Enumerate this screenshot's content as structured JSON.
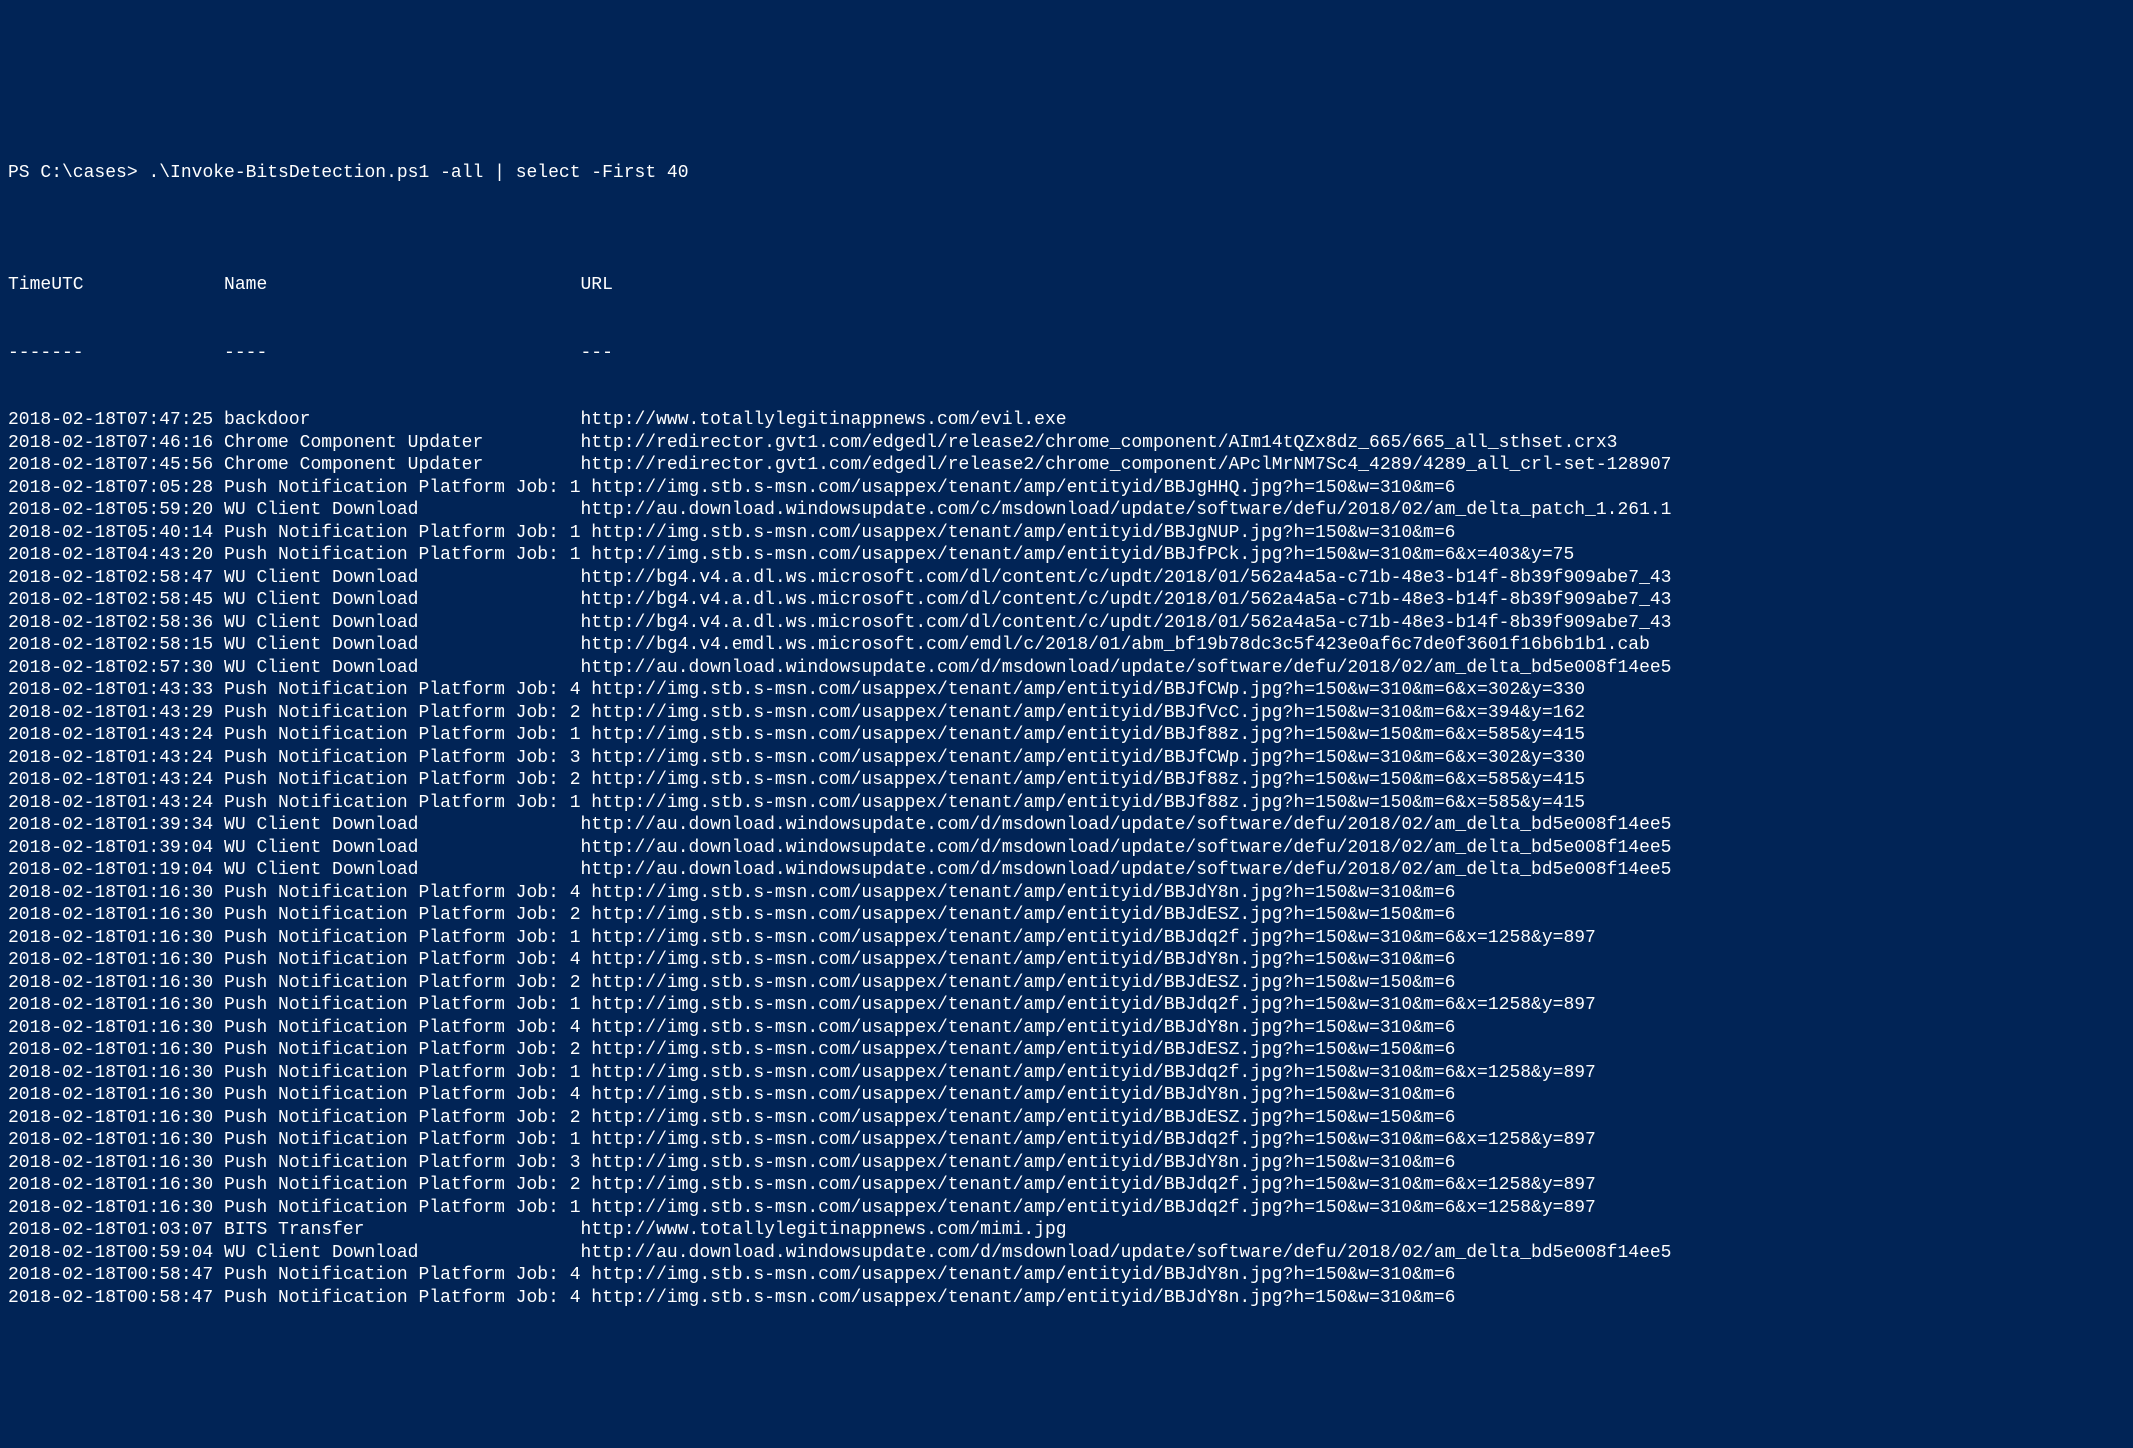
{
  "terminal": {
    "prompt": "PS C:\\cases> ",
    "command": ".\\Invoke-BitsDetection.ps1 -all | select -First 40",
    "blank_line": "",
    "columns": {
      "time_hdr": "TimeUTC",
      "name_hdr": "Name",
      "url_hdr": "URL",
      "time_sep": "-------",
      "name_sep": "----",
      "url_sep": "---"
    },
    "col_time_width": 20,
    "col_name_width": 33,
    "rows": [
      {
        "time": "2018-02-18T07:47:25",
        "name": "backdoor",
        "url": "http://www.totallylegitinappnews.com/evil.exe"
      },
      {
        "time": "2018-02-18T07:46:16",
        "name": "Chrome Component Updater",
        "url": "http://redirector.gvt1.com/edgedl/release2/chrome_component/AIm14tQZx8dz_665/665_all_sthset.crx3"
      },
      {
        "time": "2018-02-18T07:45:56",
        "name": "Chrome Component Updater",
        "url": "http://redirector.gvt1.com/edgedl/release2/chrome_component/APclMrNM7Sc4_4289/4289_all_crl-set-128907"
      },
      {
        "time": "2018-02-18T07:05:28",
        "name": "Push Notification Platform Job: 1",
        "url": "http://img.stb.s-msn.com/usappex/tenant/amp/entityid/BBJgHHQ.jpg?h=150&w=310&m=6"
      },
      {
        "time": "2018-02-18T05:59:20",
        "name": "WU Client Download",
        "url": "http://au.download.windowsupdate.com/c/msdownload/update/software/defu/2018/02/am_delta_patch_1.261.1"
      },
      {
        "time": "2018-02-18T05:40:14",
        "name": "Push Notification Platform Job: 1",
        "url": "http://img.stb.s-msn.com/usappex/tenant/amp/entityid/BBJgNUP.jpg?h=150&w=310&m=6"
      },
      {
        "time": "2018-02-18T04:43:20",
        "name": "Push Notification Platform Job: 1",
        "url": "http://img.stb.s-msn.com/usappex/tenant/amp/entityid/BBJfPCk.jpg?h=150&w=310&m=6&x=403&y=75"
      },
      {
        "time": "2018-02-18T02:58:47",
        "name": "WU Client Download",
        "url": "http://bg4.v4.a.dl.ws.microsoft.com/dl/content/c/updt/2018/01/562a4a5a-c71b-48e3-b14f-8b39f909abe7_43"
      },
      {
        "time": "2018-02-18T02:58:45",
        "name": "WU Client Download",
        "url": "http://bg4.v4.a.dl.ws.microsoft.com/dl/content/c/updt/2018/01/562a4a5a-c71b-48e3-b14f-8b39f909abe7_43"
      },
      {
        "time": "2018-02-18T02:58:36",
        "name": "WU Client Download",
        "url": "http://bg4.v4.a.dl.ws.microsoft.com/dl/content/c/updt/2018/01/562a4a5a-c71b-48e3-b14f-8b39f909abe7_43"
      },
      {
        "time": "2018-02-18T02:58:15",
        "name": "WU Client Download",
        "url": "http://bg4.v4.emdl.ws.microsoft.com/emdl/c/2018/01/abm_bf19b78dc3c5f423e0af6c7de0f3601f16b6b1b1.cab"
      },
      {
        "time": "2018-02-18T02:57:30",
        "name": "WU Client Download",
        "url": "http://au.download.windowsupdate.com/d/msdownload/update/software/defu/2018/02/am_delta_bd5e008f14ee5"
      },
      {
        "time": "2018-02-18T01:43:33",
        "name": "Push Notification Platform Job: 4",
        "url": "http://img.stb.s-msn.com/usappex/tenant/amp/entityid/BBJfCWp.jpg?h=150&w=310&m=6&x=302&y=330"
      },
      {
        "time": "2018-02-18T01:43:29",
        "name": "Push Notification Platform Job: 2",
        "url": "http://img.stb.s-msn.com/usappex/tenant/amp/entityid/BBJfVcC.jpg?h=150&w=310&m=6&x=394&y=162"
      },
      {
        "time": "2018-02-18T01:43:24",
        "name": "Push Notification Platform Job: 1",
        "url": "http://img.stb.s-msn.com/usappex/tenant/amp/entityid/BBJf88z.jpg?h=150&w=150&m=6&x=585&y=415"
      },
      {
        "time": "2018-02-18T01:43:24",
        "name": "Push Notification Platform Job: 3",
        "url": "http://img.stb.s-msn.com/usappex/tenant/amp/entityid/BBJfCWp.jpg?h=150&w=310&m=6&x=302&y=330"
      },
      {
        "time": "2018-02-18T01:43:24",
        "name": "Push Notification Platform Job: 2",
        "url": "http://img.stb.s-msn.com/usappex/tenant/amp/entityid/BBJf88z.jpg?h=150&w=150&m=6&x=585&y=415"
      },
      {
        "time": "2018-02-18T01:43:24",
        "name": "Push Notification Platform Job: 1",
        "url": "http://img.stb.s-msn.com/usappex/tenant/amp/entityid/BBJf88z.jpg?h=150&w=150&m=6&x=585&y=415"
      },
      {
        "time": "2018-02-18T01:39:34",
        "name": "WU Client Download",
        "url": "http://au.download.windowsupdate.com/d/msdownload/update/software/defu/2018/02/am_delta_bd5e008f14ee5"
      },
      {
        "time": "2018-02-18T01:39:04",
        "name": "WU Client Download",
        "url": "http://au.download.windowsupdate.com/d/msdownload/update/software/defu/2018/02/am_delta_bd5e008f14ee5"
      },
      {
        "time": "2018-02-18T01:19:04",
        "name": "WU Client Download",
        "url": "http://au.download.windowsupdate.com/d/msdownload/update/software/defu/2018/02/am_delta_bd5e008f14ee5"
      },
      {
        "time": "2018-02-18T01:16:30",
        "name": "Push Notification Platform Job: 4",
        "url": "http://img.stb.s-msn.com/usappex/tenant/amp/entityid/BBJdY8n.jpg?h=150&w=310&m=6"
      },
      {
        "time": "2018-02-18T01:16:30",
        "name": "Push Notification Platform Job: 2",
        "url": "http://img.stb.s-msn.com/usappex/tenant/amp/entityid/BBJdESZ.jpg?h=150&w=150&m=6"
      },
      {
        "time": "2018-02-18T01:16:30",
        "name": "Push Notification Platform Job: 1",
        "url": "http://img.stb.s-msn.com/usappex/tenant/amp/entityid/BBJdq2f.jpg?h=150&w=310&m=6&x=1258&y=897"
      },
      {
        "time": "2018-02-18T01:16:30",
        "name": "Push Notification Platform Job: 4",
        "url": "http://img.stb.s-msn.com/usappex/tenant/amp/entityid/BBJdY8n.jpg?h=150&w=310&m=6"
      },
      {
        "time": "2018-02-18T01:16:30",
        "name": "Push Notification Platform Job: 2",
        "url": "http://img.stb.s-msn.com/usappex/tenant/amp/entityid/BBJdESZ.jpg?h=150&w=150&m=6"
      },
      {
        "time": "2018-02-18T01:16:30",
        "name": "Push Notification Platform Job: 1",
        "url": "http://img.stb.s-msn.com/usappex/tenant/amp/entityid/BBJdq2f.jpg?h=150&w=310&m=6&x=1258&y=897"
      },
      {
        "time": "2018-02-18T01:16:30",
        "name": "Push Notification Platform Job: 4",
        "url": "http://img.stb.s-msn.com/usappex/tenant/amp/entityid/BBJdY8n.jpg?h=150&w=310&m=6"
      },
      {
        "time": "2018-02-18T01:16:30",
        "name": "Push Notification Platform Job: 2",
        "url": "http://img.stb.s-msn.com/usappex/tenant/amp/entityid/BBJdESZ.jpg?h=150&w=150&m=6"
      },
      {
        "time": "2018-02-18T01:16:30",
        "name": "Push Notification Platform Job: 1",
        "url": "http://img.stb.s-msn.com/usappex/tenant/amp/entityid/BBJdq2f.jpg?h=150&w=310&m=6&x=1258&y=897"
      },
      {
        "time": "2018-02-18T01:16:30",
        "name": "Push Notification Platform Job: 4",
        "url": "http://img.stb.s-msn.com/usappex/tenant/amp/entityid/BBJdY8n.jpg?h=150&w=310&m=6"
      },
      {
        "time": "2018-02-18T01:16:30",
        "name": "Push Notification Platform Job: 2",
        "url": "http://img.stb.s-msn.com/usappex/tenant/amp/entityid/BBJdESZ.jpg?h=150&w=150&m=6"
      },
      {
        "time": "2018-02-18T01:16:30",
        "name": "Push Notification Platform Job: 1",
        "url": "http://img.stb.s-msn.com/usappex/tenant/amp/entityid/BBJdq2f.jpg?h=150&w=310&m=6&x=1258&y=897"
      },
      {
        "time": "2018-02-18T01:16:30",
        "name": "Push Notification Platform Job: 3",
        "url": "http://img.stb.s-msn.com/usappex/tenant/amp/entityid/BBJdY8n.jpg?h=150&w=310&m=6"
      },
      {
        "time": "2018-02-18T01:16:30",
        "name": "Push Notification Platform Job: 2",
        "url": "http://img.stb.s-msn.com/usappex/tenant/amp/entityid/BBJdq2f.jpg?h=150&w=310&m=6&x=1258&y=897"
      },
      {
        "time": "2018-02-18T01:16:30",
        "name": "Push Notification Platform Job: 1",
        "url": "http://img.stb.s-msn.com/usappex/tenant/amp/entityid/BBJdq2f.jpg?h=150&w=310&m=6&x=1258&y=897"
      },
      {
        "time": "2018-02-18T01:03:07",
        "name": "BITS Transfer",
        "url": "http://www.totallylegitinappnews.com/mimi.jpg"
      },
      {
        "time": "2018-02-18T00:59:04",
        "name": "WU Client Download",
        "url": "http://au.download.windowsupdate.com/d/msdownload/update/software/defu/2018/02/am_delta_bd5e008f14ee5"
      },
      {
        "time": "2018-02-18T00:58:47",
        "name": "Push Notification Platform Job: 4",
        "url": "http://img.stb.s-msn.com/usappex/tenant/amp/entityid/BBJdY8n.jpg?h=150&w=310&m=6"
      },
      {
        "time": "2018-02-18T00:58:47",
        "name": "Push Notification Platform Job: 4",
        "url": "http://img.stb.s-msn.com/usappex/tenant/amp/entityid/BBJdY8n.jpg?h=150&w=310&m=6"
      }
    ]
  }
}
